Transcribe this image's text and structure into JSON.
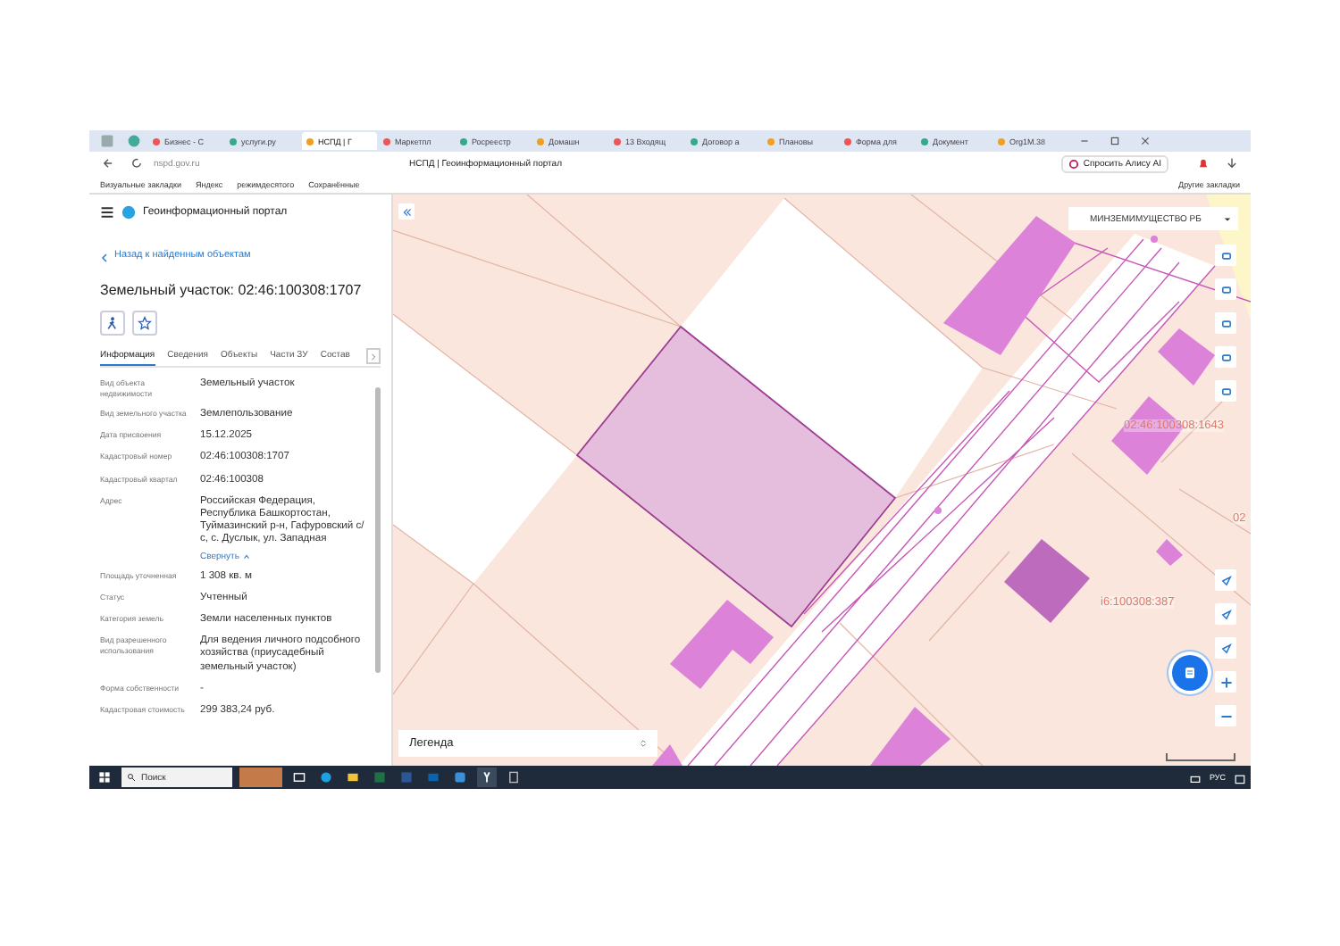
{
  "browser": {
    "tabs": [
      {
        "label": "Бизнес - С",
        "selected": false
      },
      {
        "label": "услуги.ру",
        "selected": false
      },
      {
        "label": "НСПД | Г",
        "selected": true
      },
      {
        "label": "Маркетпл",
        "selected": false
      },
      {
        "label": "Росреестр",
        "selected": false
      },
      {
        "label": "Домашн",
        "selected": false
      },
      {
        "label": "13 Входящ",
        "selected": false
      },
      {
        "label": "Договор а",
        "selected": false
      },
      {
        "label": "Плановы",
        "selected": false
      },
      {
        "label": "Форма для",
        "selected": false
      },
      {
        "label": "Документ",
        "selected": false
      },
      {
        "label": "Org1М.38",
        "selected": false
      }
    ],
    "address": "nspd.gov.ru",
    "page_title": "НСПД | Геоинформационный портал",
    "alice_button": "Спросить Алису AI",
    "bookmarks": [
      "Визуальные закладки",
      "Яндекс",
      "режимдесятого",
      "Сохранённые"
    ],
    "other_bookmarks": "Другие закладки"
  },
  "panel": {
    "app_title": "Геоинформационный портал",
    "back_link": "Назад к найденным объектам",
    "object_title": "Земельный участок: 02:46:100308:1707",
    "tabs": [
      {
        "label": "Информация",
        "selected": true
      },
      {
        "label": "Сведения",
        "selected": false
      },
      {
        "label": "Объекты",
        "selected": false
      },
      {
        "label": "Части ЗУ",
        "selected": false
      },
      {
        "label": "Состав",
        "selected": false
      }
    ],
    "fields": [
      {
        "label": "Вид объекта недвижимости",
        "value": "Земельный участок"
      },
      {
        "label": "Вид земельного участка",
        "value": "Землепользование"
      },
      {
        "label": "Дата присвоения",
        "value": "15.12.2025"
      },
      {
        "label": "Кадастровый номер",
        "value": "02:46:100308:1707"
      },
      {
        "label": "Кадастровый квартал",
        "value": "02:46:100308"
      },
      {
        "label": "Адрес",
        "value": "Российская Федерация, Республика Башкортостан, Туймазинский р-н, Гафуровский с/с, с. Дуслык, ул. Западная",
        "link": "Свернуть"
      },
      {
        "label": "Площадь уточненная",
        "value": "1 308 кв. м"
      },
      {
        "label": "Статус",
        "value": "Учтенный"
      },
      {
        "label": "Категория земель",
        "value": "Земли населенных пунктов"
      },
      {
        "label": "Вид разрешенного использования",
        "value": "Для ведения личного подсобного хозяйства (приусадебный земельный участок)"
      },
      {
        "label": "Форма собственности",
        "value": "-"
      },
      {
        "label": "Кадастровая стоимость",
        "value": "299 383,24 руб."
      }
    ]
  },
  "map": {
    "layer_select": "МИНЗЕМИМУЩЕСТВО РБ",
    "labels": [
      "02:46:100308:1643",
      "i6:100308:387",
      "02"
    ],
    "legend": "Легенда"
  },
  "taskbar": {
    "search": "Поиск",
    "language": "РУС"
  }
}
